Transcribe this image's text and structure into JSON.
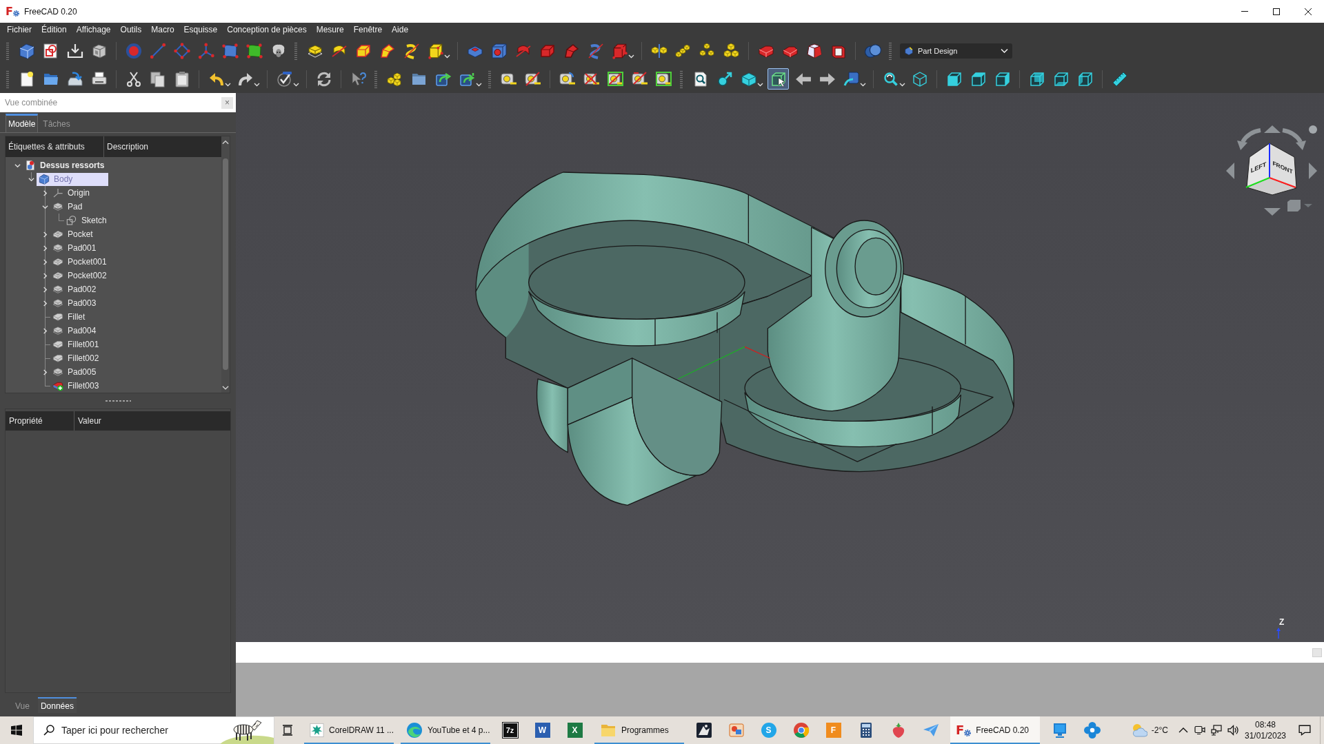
{
  "window": {
    "title": "FreeCAD 0.20",
    "logo": "F"
  },
  "menu": [
    "Fichier",
    "Édition",
    "Affichage",
    "Outils",
    "Macro",
    "Esquisse",
    "Conception de pièces",
    "Mesure",
    "Fenêtre",
    "Aide"
  ],
  "toolbar": {
    "selection_tool": {
      "on": true
    },
    "workbench": "Part Design"
  },
  "combo_view": {
    "title": "Vue combinée",
    "close_label": "×",
    "tabs": [
      {
        "label": "Modèle",
        "selected": true
      },
      {
        "label": "Tâches",
        "selected": false
      }
    ],
    "tree": {
      "columns": [
        "Étiquettes & attributs",
        "Description"
      ],
      "items": [
        {
          "label": "Dessus ressorts",
          "kind": "document",
          "selected": false,
          "expanded": true,
          "children": [
            {
              "label": "Body",
              "kind": "body",
              "selected": true,
              "expanded": true,
              "children": [
                {
                  "label": "Origin",
                  "kind": "origin",
                  "selected": false,
                  "expanded": false
                },
                {
                  "label": "Pad",
                  "kind": "pad",
                  "selected": false,
                  "expanded": true,
                  "children": [
                    {
                      "label": "Sketch",
                      "kind": "sketch",
                      "selected": false
                    }
                  ]
                },
                {
                  "label": "Pocket",
                  "kind": "pocket",
                  "selected": false,
                  "expanded": false
                },
                {
                  "label": "Pad001",
                  "kind": "pad",
                  "selected": false,
                  "expanded": false
                },
                {
                  "label": "Pocket001",
                  "kind": "pocket",
                  "selected": false,
                  "expanded": false
                },
                {
                  "label": "Pocket002",
                  "kind": "pocket",
                  "selected": false,
                  "expanded": false
                },
                {
                  "label": "Pad002",
                  "kind": "pad",
                  "selected": false,
                  "expanded": false
                },
                {
                  "label": "Pad003",
                  "kind": "pad",
                  "selected": false,
                  "expanded": false
                },
                {
                  "label": "Fillet",
                  "kind": "fillet",
                  "selected": false
                },
                {
                  "label": "Pad004",
                  "kind": "pad",
                  "selected": false,
                  "expanded": false
                },
                {
                  "label": "Fillet001",
                  "kind": "fillet",
                  "selected": false
                },
                {
                  "label": "Fillet002",
                  "kind": "fillet",
                  "selected": false
                },
                {
                  "label": "Pad005",
                  "kind": "pad",
                  "selected": false,
                  "expanded": false
                },
                {
                  "label": "Fillet003",
                  "kind": "tip",
                  "selected": false
                }
              ]
            }
          ]
        }
      ]
    },
    "properties": {
      "columns": [
        "Propriété",
        "Valeur"
      ]
    },
    "bottom_tabs": [
      {
        "label": "Vue",
        "selected": false
      },
      {
        "label": "Données",
        "selected": true
      }
    ]
  },
  "viewport": {
    "navigation_cube": {
      "faces": [
        "LEFT",
        "FRONT"
      ]
    },
    "axis_label": "Z"
  },
  "taskbar": {
    "search": {
      "placeholder": "Taper ici pour rechercher"
    },
    "apps": [
      {
        "kind": "corel",
        "label": "CorelDRAW 11 ...",
        "open": true,
        "selected": false
      },
      {
        "kind": "edge",
        "label": "YouTube et 4 p...",
        "open": true,
        "selected": false
      },
      {
        "kind": "archiver",
        "glyph": "7z",
        "open": false,
        "selected": false
      },
      {
        "kind": "word",
        "glyph": "W",
        "open": false,
        "selected": false
      },
      {
        "kind": "excel",
        "glyph": "X",
        "open": false,
        "selected": false
      },
      {
        "kind": "folder",
        "label": "Programmes",
        "open": true,
        "selected": false
      },
      {
        "kind": "reader",
        "open": false,
        "selected": false
      },
      {
        "kind": "paint",
        "open": false,
        "selected": false
      },
      {
        "kind": "skype",
        "glyph": "S",
        "open": false,
        "selected": false
      },
      {
        "kind": "chrome",
        "open": false,
        "selected": false
      },
      {
        "kind": "fusion",
        "glyph": "F",
        "open": false,
        "selected": false
      },
      {
        "kind": "calculator",
        "open": false,
        "selected": false
      },
      {
        "kind": "strawberry",
        "open": false,
        "selected": false
      },
      {
        "kind": "plane",
        "open": false,
        "selected": false
      },
      {
        "kind": "freecad",
        "glyph": "F",
        "label": "FreeCAD 0.20",
        "open": true,
        "selected": true
      },
      {
        "kind": "monitor",
        "open": false,
        "selected": false
      },
      {
        "kind": "cross",
        "open": false,
        "selected": false
      }
    ],
    "weather": "-2°C",
    "clock": {
      "time": "08:48",
      "date": "31/01/2023"
    }
  }
}
